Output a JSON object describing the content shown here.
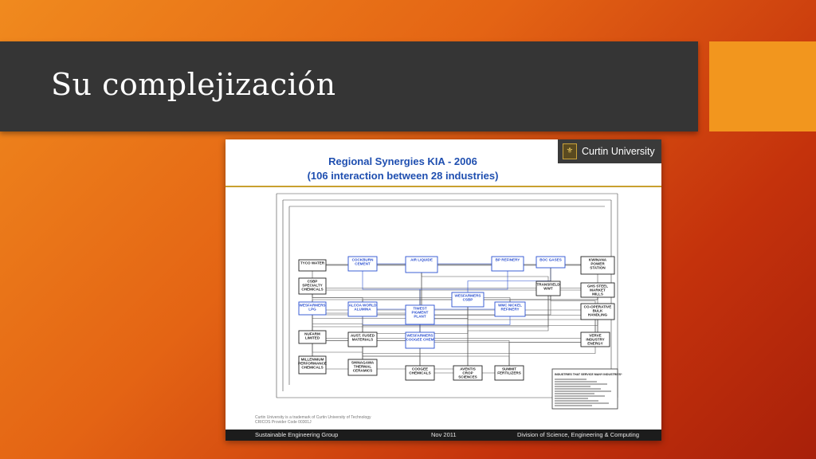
{
  "slide": {
    "title": "Su complejización",
    "colors": {
      "bar": "#353535",
      "accent": "#f2961e",
      "gradient_start": "#f08a1e",
      "gradient_end": "#a8200a"
    }
  },
  "figure": {
    "title_line1": "Regional Synergies KIA - 2006",
    "title_line2": "(106 interaction between 28 industries)",
    "logo_text": "Curtin University",
    "footnote_line1": "Curtin University is a trademark of Curtin University of Technology",
    "footnote_line2": "CRICOS Provider Code 00301J",
    "footer_left": "Sustainable Engineering Group",
    "footer_mid": "Nov 2011",
    "footer_right": "Division of Science, Engineering & Computing",
    "industries_box": "INDUSTRIES THAT SERVICE MANY INDUSTRIES*",
    "nodes": [
      {
        "id": "tyco",
        "label": "TYCO WATER",
        "color": "black"
      },
      {
        "id": "csbp",
        "label": "CSBP SPECIALTY CHEMICALS",
        "color": "black"
      },
      {
        "id": "wes-lpg",
        "label": "WESFARMERS LPG",
        "color": "blue"
      },
      {
        "id": "nufarm",
        "label": "NUFARM LIMITED",
        "color": "black"
      },
      {
        "id": "millennium",
        "label": "MILLENNIUM PERFORMANCE CHEMICALS",
        "color": "black"
      },
      {
        "id": "cockburn",
        "label": "COCKBURN CEMENT",
        "color": "blue"
      },
      {
        "id": "alcoa",
        "label": "ALCOA WORLD ALUMINA",
        "color": "blue"
      },
      {
        "id": "aust-fused",
        "label": "AUST. FUSED MATERIALS",
        "color": "black"
      },
      {
        "id": "bhp",
        "label": "SHINAGAWA THERMAL CERAMICS",
        "color": "black"
      },
      {
        "id": "airliquide",
        "label": "AIR LIQUIDE",
        "color": "blue"
      },
      {
        "id": "tiwest",
        "label": "TIWEST PIGMENT PLANT",
        "color": "blue"
      },
      {
        "id": "wes-cogen",
        "label": "WESFARMERS COOGEE CHEM",
        "color": "blue"
      },
      {
        "id": "coogee",
        "label": "COOGEE CHEMICALS",
        "color": "black"
      },
      {
        "id": "wes-csbp",
        "label": "WESFARMERS CSBP",
        "color": "blue"
      },
      {
        "id": "aventis",
        "label": "AVENTIS CROP SCIENCES",
        "color": "black"
      },
      {
        "id": "bp",
        "label": "BP REFINERY",
        "color": "blue"
      },
      {
        "id": "wmc",
        "label": "WMC NICKEL REFINERY",
        "color": "blue"
      },
      {
        "id": "summit",
        "label": "SUMMIT FERTILIZERS",
        "color": "black"
      },
      {
        "id": "boc",
        "label": "BOC GASES",
        "color": "blue"
      },
      {
        "id": "transfield",
        "label": "TRANSFIELD WWT",
        "color": "black"
      },
      {
        "id": "kwinana",
        "label": "KWINANA POWER STATION",
        "color": "black"
      },
      {
        "id": "ghs",
        "label": "GHS STEEL MARKET MILLS",
        "color": "black"
      },
      {
        "id": "coop",
        "label": "CO-OPERATIVE BULK HANDLING",
        "color": "black"
      },
      {
        "id": "verve",
        "label": "VERVE INDUSTRY ENERGY",
        "color": "black"
      }
    ]
  }
}
